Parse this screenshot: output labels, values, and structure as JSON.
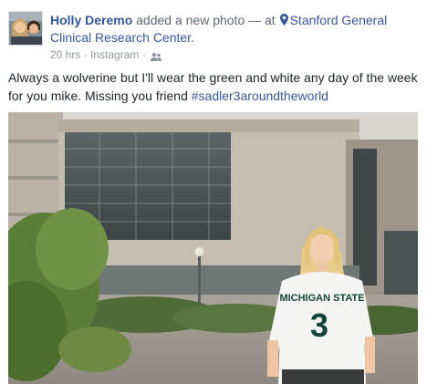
{
  "post": {
    "author": "Holly Deremo",
    "action": " added a new photo — at ",
    "place": "Stanford General Clinical Research Center",
    "place_suffix": ".",
    "timestamp": "20 hrs",
    "separator": " · ",
    "source": "Instagram",
    "separator2": " · ",
    "privacy_icon": "friends-icon",
    "location_icon": "map-pin-icon",
    "text": "Always a wolverine but I'll wear the green and white any day of the week for you mike. Missing you friend ",
    "hashtag": "#sadler3aroundtheworld",
    "photo": {
      "shirt_text": "MICHIGAN STATE",
      "shirt_number": "3"
    }
  },
  "colors": {
    "link": "#365899",
    "text": "#1d2129",
    "meta": "#90949c",
    "shirt_green": "#18453b"
  }
}
